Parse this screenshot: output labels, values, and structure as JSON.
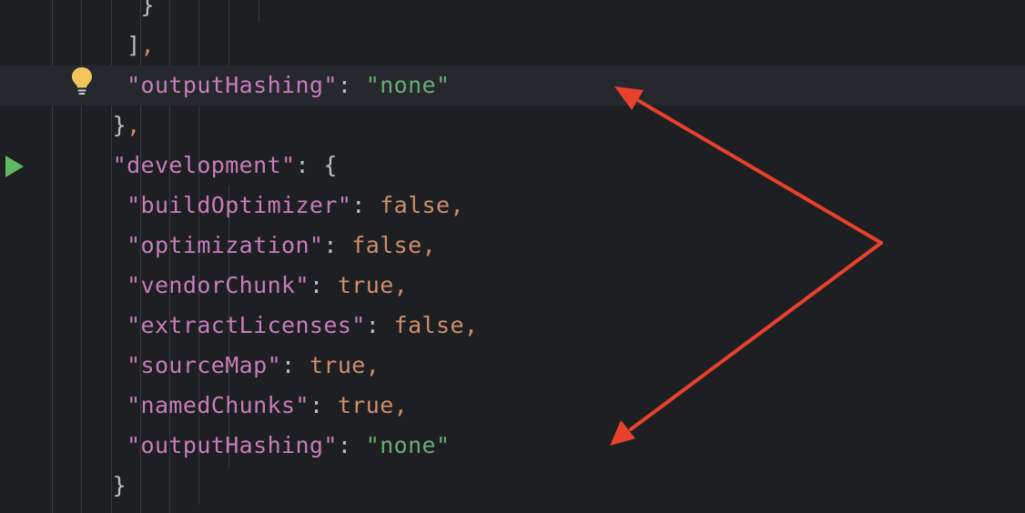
{
  "colors": {
    "background": "#1e1f22",
    "current_line": "#26282e",
    "key": "#c77dbb",
    "string": "#6aab73",
    "boolean": "#cf8e6d",
    "punctuation": "#bcbec4",
    "annotation_arrow": "#e8412c",
    "run_icon": "#5fb865",
    "bulb_icon": "#f2c55c"
  },
  "gutter": {
    "bulb_icon": "lightbulb-icon",
    "run_icon": "run-gutter-icon"
  },
  "code": {
    "l0": {
      "text": "}"
    },
    "l1": {
      "bracket": "]",
      "comma": ","
    },
    "l2": {
      "key": "\"outputHashing\"",
      "colon": ": ",
      "value": "\"none\""
    },
    "l3": {
      "brace": "}",
      "comma": ","
    },
    "l4": {
      "key": "\"development\"",
      "colon": ": ",
      "brace": "{"
    },
    "l5": {
      "key": "\"buildOptimizer\"",
      "colon": ": ",
      "value": "false",
      "comma": ","
    },
    "l6": {
      "key": "\"optimization\"",
      "colon": ": ",
      "value": "false",
      "comma": ","
    },
    "l7": {
      "key": "\"vendorChunk\"",
      "colon": ": ",
      "value": "true",
      "comma": ","
    },
    "l8": {
      "key": "\"extractLicenses\"",
      "colon": ": ",
      "value": "false",
      "comma": ","
    },
    "l9": {
      "key": "\"sourceMap\"",
      "colon": ": ",
      "value": "true",
      "comma": ","
    },
    "l10": {
      "key": "\"namedChunks\"",
      "colon": ": ",
      "value": "true",
      "comma": ","
    },
    "l11": {
      "key": "\"outputHashing\"",
      "colon": ": ",
      "value": "\"none\""
    },
    "l12": {
      "brace": "}"
    }
  },
  "annotation": {
    "arrow_icon": "red-annotation-arrows"
  }
}
